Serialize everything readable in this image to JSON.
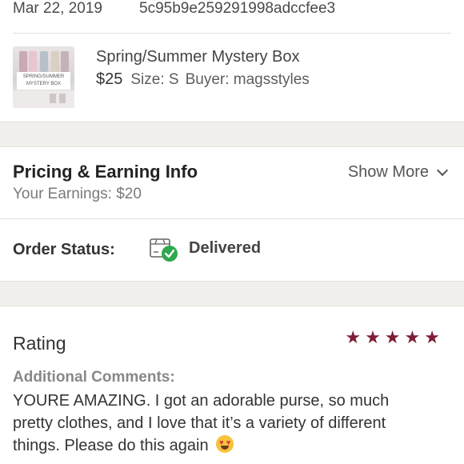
{
  "order": {
    "date": "Mar 22, 2019",
    "id": "5c95b9e259291998adccfee3"
  },
  "item": {
    "title": "Spring/Summer Mystery Box",
    "price": "$25",
    "size": "Size: S",
    "buyer": "Buyer: magsstyles",
    "thumb_caption": "SPRING/SUMMER MYSTERY BOX"
  },
  "pricing": {
    "title": "Pricing & Earning Info",
    "earnings": "Your Earnings: $20",
    "show_more": "Show More",
    "show_more_icon": "chevron-down-icon"
  },
  "status": {
    "label": "Order Status:",
    "value": "Delivered",
    "icon": "box-delivered-check-icon",
    "check_color": "#2fa84f"
  },
  "rating": {
    "label": "Rating",
    "stars": 5,
    "max_stars": 5,
    "star_color": "#7e1d35",
    "comments_label": "Additional Comments:",
    "comment": "YOURE AMAZING. I got an adorable purse, so much pretty clothes, and I love that it’s a variety of different things. Please do this again",
    "comment_emoji": "heart-eyes-emoji"
  }
}
